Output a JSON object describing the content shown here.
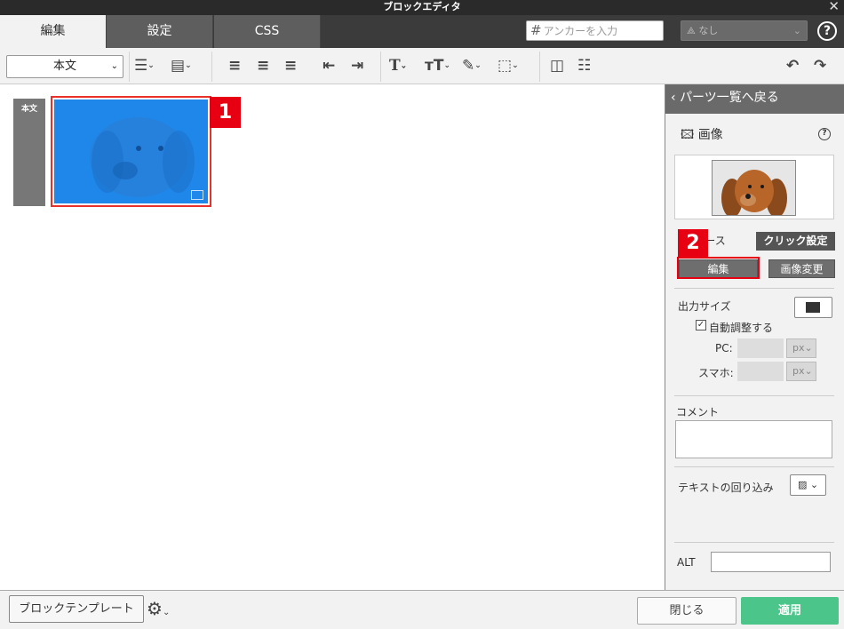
{
  "window": {
    "title": "ブロックエディタ",
    "close_glyph": "✕"
  },
  "tabs": [
    {
      "label": "編集",
      "active": true
    },
    {
      "label": "設定",
      "active": false
    },
    {
      "label": "CSS",
      "active": false
    }
  ],
  "header": {
    "anchor_placeholder": "アンカーを入力",
    "anchor_hash": "#",
    "link_select": "なし",
    "help_glyph": "?"
  },
  "toolbar": {
    "style_select": "本文",
    "icons": [
      "bullet-list-icon",
      "numbered-list-icon",
      "align-left-icon",
      "align-center-icon",
      "align-right-icon",
      "outdent-icon",
      "indent-icon",
      "text-size-icon",
      "font-size-icon",
      "color-picker-icon",
      "text-border-icon",
      "column-split-icon",
      "clear-format-icon",
      "undo-icon",
      "redo-icon"
    ]
  },
  "canvas": {
    "block_label": "本文"
  },
  "callouts": {
    "one": "1",
    "two": "2"
  },
  "panel": {
    "back_label": "パーツ一覧へ戻る",
    "title": "画像",
    "tabs": {
      "source": "ース",
      "click_settings": "クリック設定"
    },
    "edit_button": "編集",
    "change_image_button": "画像変更",
    "output_size_label": "出力サイズ",
    "auto_adjust_label": "自動調整する",
    "auto_adjust_checked": true,
    "pc_label": "PC:",
    "sp_label": "スマホ:",
    "unit": "px",
    "comment_label": "コメント",
    "text_wrap_label": "テキストの回り込み",
    "alt_label": "ALT"
  },
  "footer": {
    "template_button": "ブロックテンプレート",
    "close_button": "閉じる",
    "apply_button": "適用"
  },
  "colors": {
    "accent": "#4cc58a",
    "selection": "#1f87ea",
    "callout": "#e60012"
  }
}
